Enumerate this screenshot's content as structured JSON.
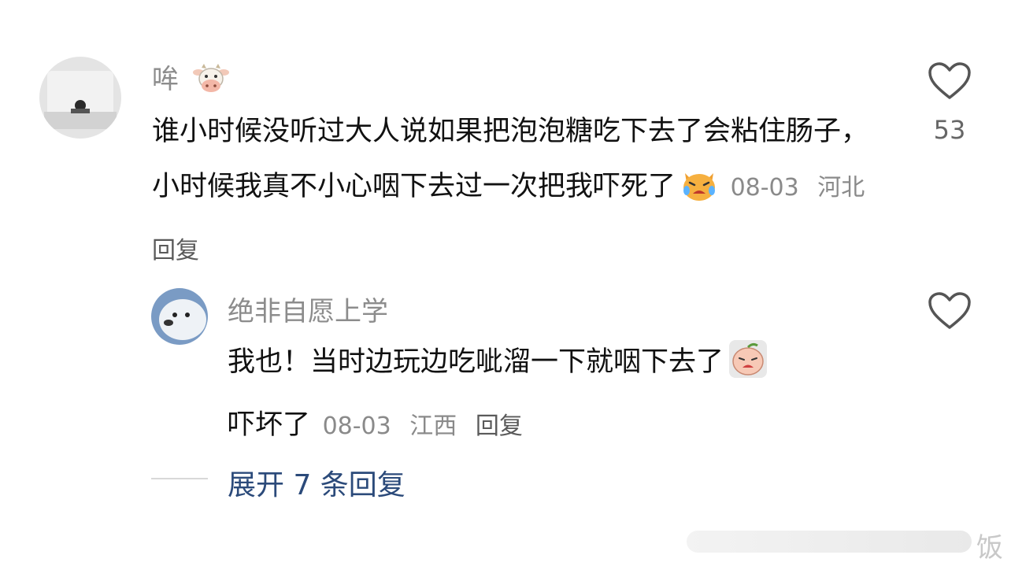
{
  "comments": [
    {
      "username": "哞",
      "username_emoji": "cow-face-emoji",
      "text": "谁小时候没听过大人说如果把泡泡糖吃下去了会粘住肠子，小时候我真不小心咽下去过一次把我吓死了",
      "text_emoji": "crying-cat-emoji",
      "date": "08-03",
      "location": "河北",
      "reply_label": "回复",
      "likes": "53"
    }
  ],
  "replies": [
    {
      "username": "绝非自愿上学",
      "text": "我也！当时边玩边吃呲溜一下就咽下去了",
      "text_emoji": "crying-peach-emoji",
      "text_tail": "吓坏了",
      "date": "08-03",
      "location": "江西",
      "reply_label": "回复"
    }
  ],
  "expand_label": "展开 7 条回复",
  "watermark": "饭",
  "colors": {
    "username": "#8c8c8c",
    "text": "#111111",
    "meta": "#8a8a8a",
    "expand": "#2b4a7a"
  }
}
